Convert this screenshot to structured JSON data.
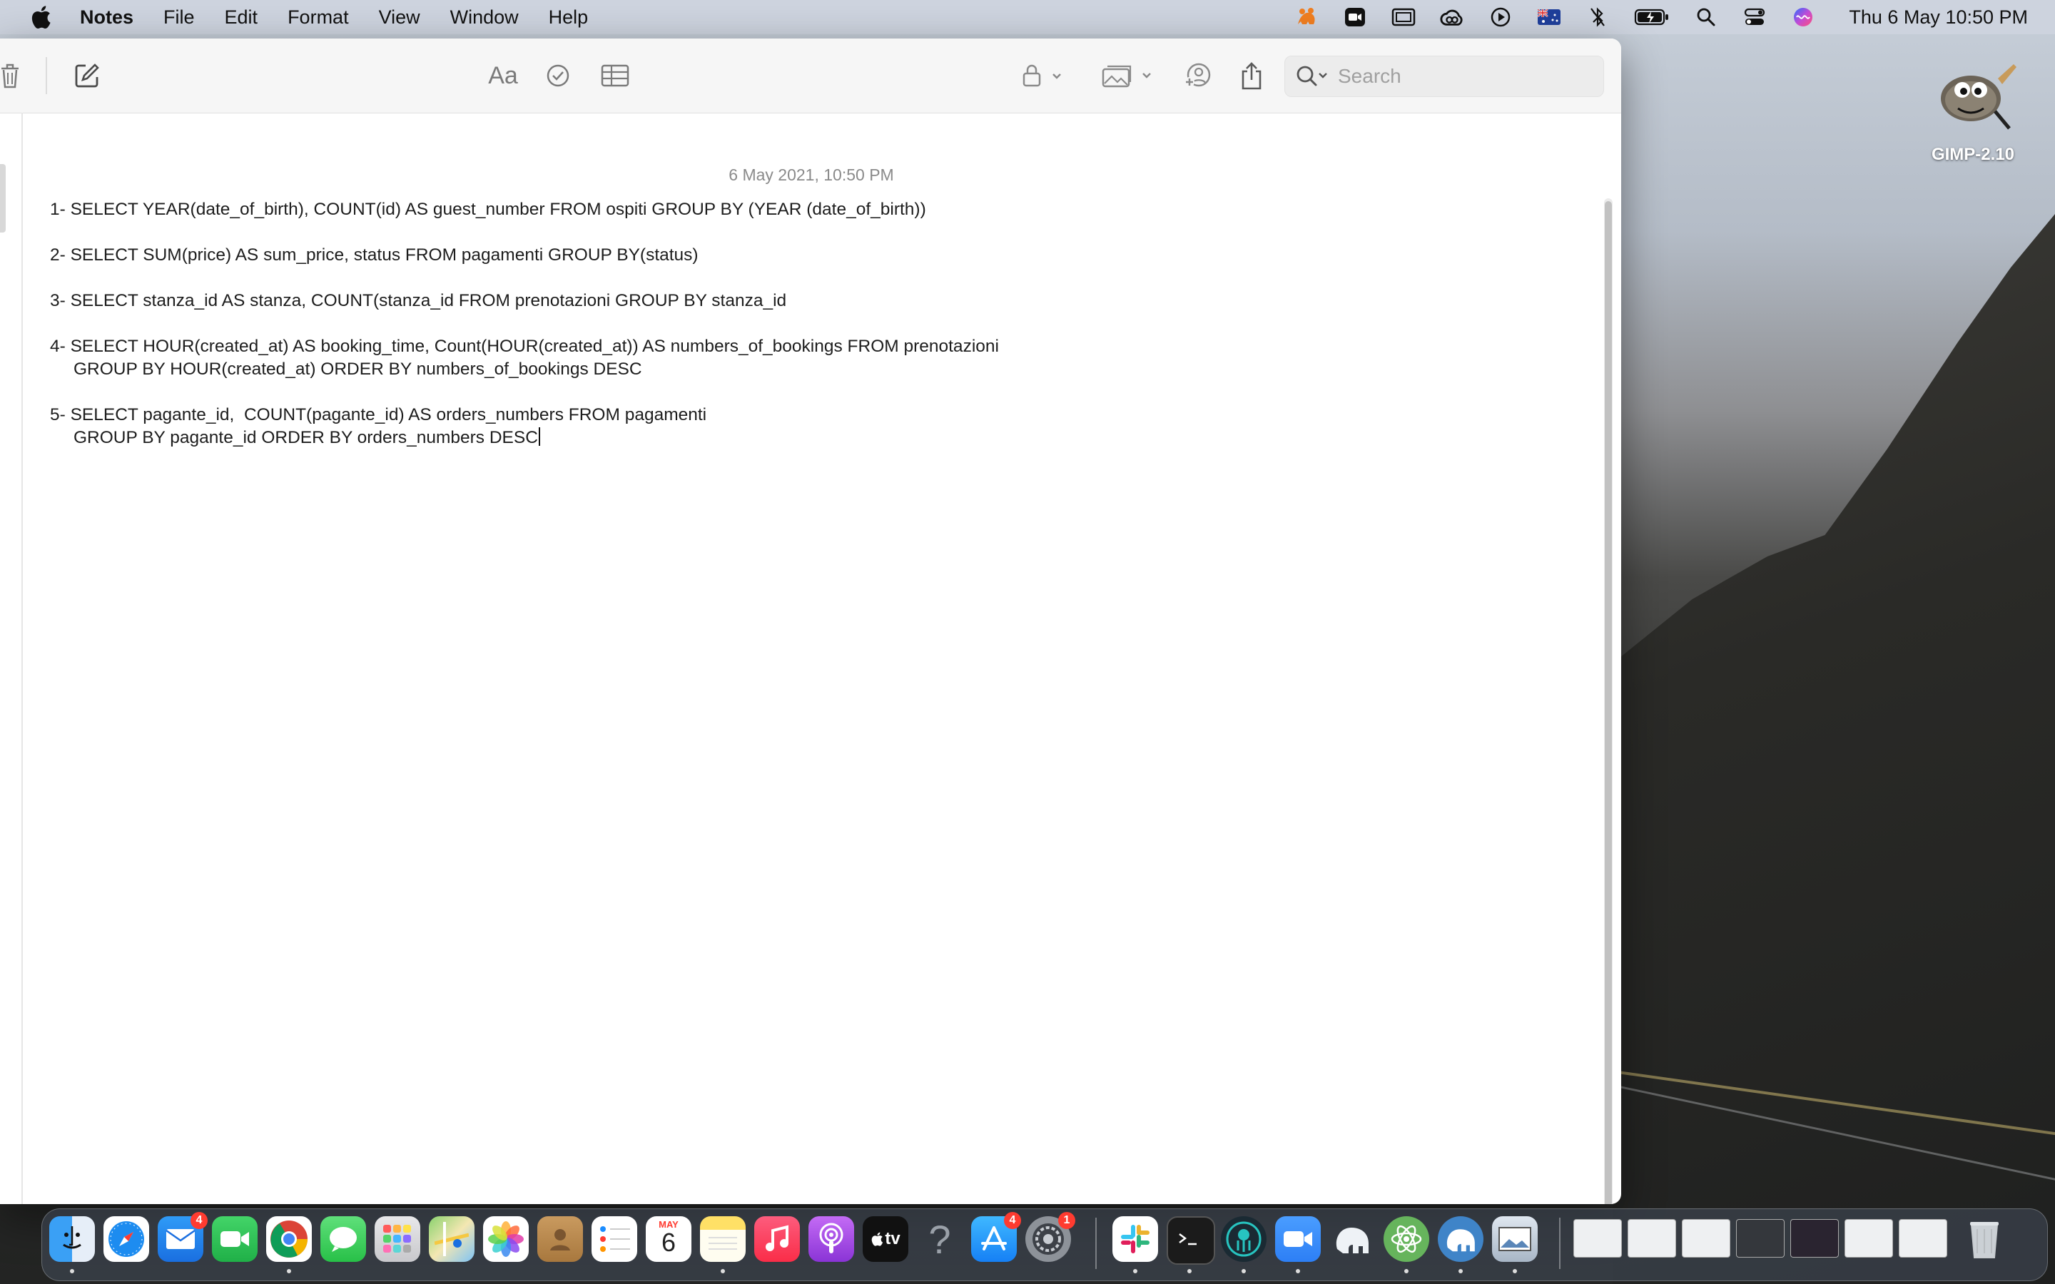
{
  "menubar": {
    "app_name": "Notes",
    "items": [
      "File",
      "Edit",
      "Format",
      "View",
      "Window",
      "Help"
    ],
    "clock": "Thu 6 May  10:50 PM"
  },
  "toolbar": {
    "search_placeholder": "Search",
    "format_label": "Aa"
  },
  "note": {
    "date": "6 May 2021, 10:50 PM",
    "queries": [
      {
        "line1": "1- SELECT YEAR(date_of_birth), COUNT(id) AS guest_number FROM ospiti GROUP BY (YEAR (date_of_birth))",
        "line2": ""
      },
      {
        "line1": "2- SELECT SUM(price) AS sum_price, status FROM pagamenti GROUP BY(status)",
        "line2": ""
      },
      {
        "line1": "3- SELECT stanza_id AS stanza, COUNT(stanza_id FROM prenotazioni GROUP BY stanza_id",
        "line2": ""
      },
      {
        "line1": "4- SELECT HOUR(created_at) AS booking_time, Count(HOUR(created_at)) AS numbers_of_bookings FROM prenotazioni",
        "line2": "GROUP BY HOUR(created_at) ORDER BY numbers_of_bookings DESC"
      },
      {
        "line1": "5- SELECT pagante_id,  COUNT(pagante_id) AS orders_numbers FROM pagamenti",
        "line2": "GROUP BY pagante_id ORDER BY orders_numbers DESC"
      }
    ]
  },
  "desktop": {
    "gimp_label": "GIMP-2.10"
  },
  "dock": {
    "calendar_month": "MAY",
    "calendar_day": "6",
    "mail_badge": "4",
    "appstore_badge": "4",
    "settings_badge": "1",
    "tv_label": "tv",
    "help_label": "?"
  }
}
